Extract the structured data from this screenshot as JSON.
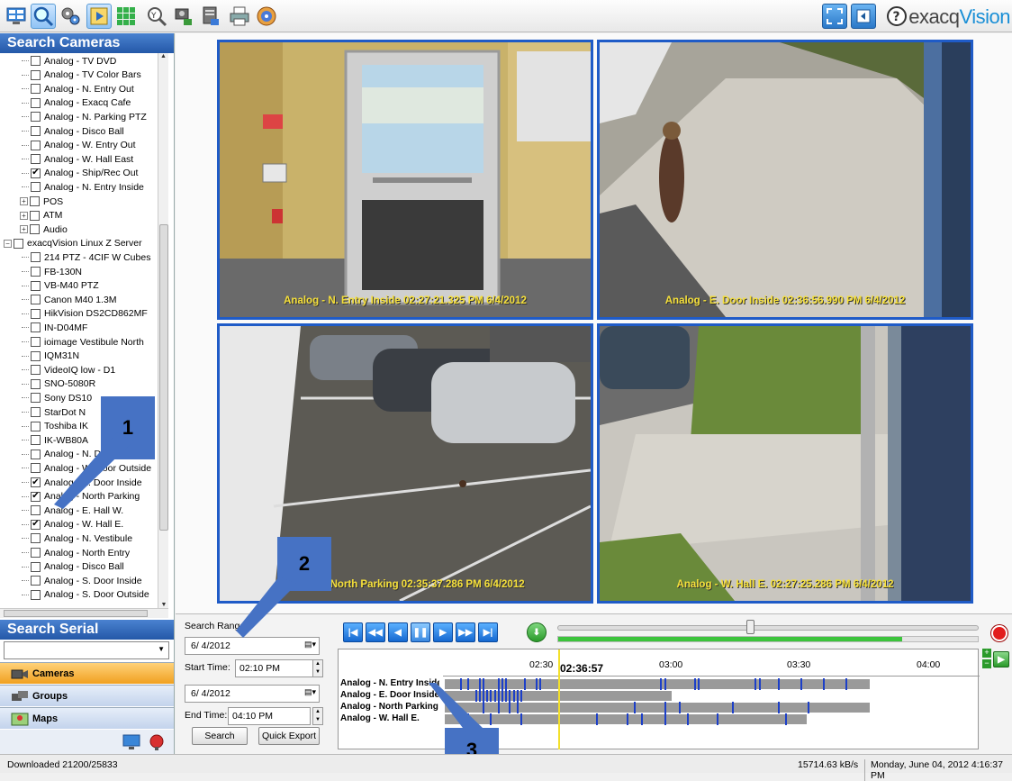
{
  "toolbar": {
    "brand_prefix": "exacq",
    "brand_suffix": "Vision"
  },
  "left_panel": {
    "search_cameras_title": "Search Cameras",
    "search_serial_title": "Search Serial",
    "tree_items": [
      {
        "label": "Analog - TV DVD",
        "checked": false
      },
      {
        "label": "Analog - TV Color Bars",
        "checked": false
      },
      {
        "label": "Analog - N. Entry Out",
        "checked": false
      },
      {
        "label": "Analog - Exacq Cafe",
        "checked": false
      },
      {
        "label": "Analog - N. Parking PTZ",
        "checked": false
      },
      {
        "label": "Analog - Disco Ball",
        "checked": false
      },
      {
        "label": "Analog - W. Entry Out",
        "checked": false
      },
      {
        "label": "Analog - W. Hall East",
        "checked": false
      },
      {
        "label": "Analog - Ship/Rec Out",
        "checked": true
      },
      {
        "label": "Analog - N. Entry Inside",
        "checked": false
      },
      {
        "label": "POS",
        "checked": false
      },
      {
        "label": "ATM",
        "checked": false
      },
      {
        "label": "Audio",
        "checked": false
      },
      {
        "label": "exacqVision Linux Z Server",
        "checked": false
      },
      {
        "label": "214 PTZ - 4CIF W Cubes",
        "checked": false
      },
      {
        "label": "FB-130N",
        "checked": false
      },
      {
        "label": "VB-M40 PTZ",
        "checked": false
      },
      {
        "label": "Canon M40 1.3M",
        "checked": false
      },
      {
        "label": "HikVision DS2CD862MF",
        "checked": false
      },
      {
        "label": "IN-D04MF",
        "checked": false
      },
      {
        "label": "ioimage Vestibule North",
        "checked": false
      },
      {
        "label": "IQM31N",
        "checked": false
      },
      {
        "label": "VideoIQ low - D1",
        "checked": false
      },
      {
        "label": "SNO-5080R",
        "checked": false
      },
      {
        "label": "Sony DS10",
        "checked": false
      },
      {
        "label": "StarDot N",
        "checked": false
      },
      {
        "label": "Toshiba IK",
        "checked": false
      },
      {
        "label": "IK-WB80A",
        "checked": false
      },
      {
        "label": "Analog - N. Door Outside",
        "checked": false
      },
      {
        "label": "Analog - W. Door Outside",
        "checked": false
      },
      {
        "label": "Analog - E. Door Inside",
        "checked": true
      },
      {
        "label": "Analog - North Parking",
        "checked": true
      },
      {
        "label": "Analog - E. Hall W.",
        "checked": false
      },
      {
        "label": "Analog - W. Hall E.",
        "checked": true
      },
      {
        "label": "Analog - N. Vestibule",
        "checked": false
      },
      {
        "label": "Analog - North Entry",
        "checked": false
      },
      {
        "label": "Analog - Disco Ball",
        "checked": false
      },
      {
        "label": "Analog - S. Door Inside",
        "checked": false
      },
      {
        "label": "Analog - S. Door Outside",
        "checked": false
      }
    ],
    "nav": {
      "cameras": "Cameras",
      "groups": "Groups",
      "maps": "Maps"
    }
  },
  "video": {
    "tiles": [
      {
        "caption": "Analog - N. Entry Inside 02:27:21.325 PM 6/4/2012"
      },
      {
        "caption": "Analog - E. Door Inside 02:36:56.990 PM 6/4/2012"
      },
      {
        "caption": "Analog - North Parking 02:35:37.286 PM 6/4/2012"
      },
      {
        "caption": "Analog - W. Hall E. 02:27:25.286 PM 6/4/2012"
      }
    ]
  },
  "search": {
    "range_label": "Search Range",
    "start_date": "6/ 4/2012",
    "start_time_label": "Start Time:",
    "start_time": "02:10 PM",
    "end_date": "6/ 4/2012",
    "end_time_label": "End Time:",
    "end_time": "04:10 PM",
    "search_button": "Search",
    "quick_export_button": "Quick Export"
  },
  "timeline": {
    "current_time": "02:36:57",
    "ticks": [
      "02:30",
      "03:00",
      "03:30",
      "04:00"
    ],
    "rows": [
      {
        "name": "Analog - N. Entry Inside"
      },
      {
        "name": "Analog - E. Door Inside"
      },
      {
        "name": "Analog - North Parking"
      },
      {
        "name": "Analog - W. Hall E."
      }
    ]
  },
  "status": {
    "downloaded": "Downloaded 21200/25833",
    "rate": "15714.63 kB/s",
    "datetime": "Monday, June 04, 2012  4:16:37 PM"
  },
  "callouts": [
    "1",
    "2",
    "3"
  ]
}
